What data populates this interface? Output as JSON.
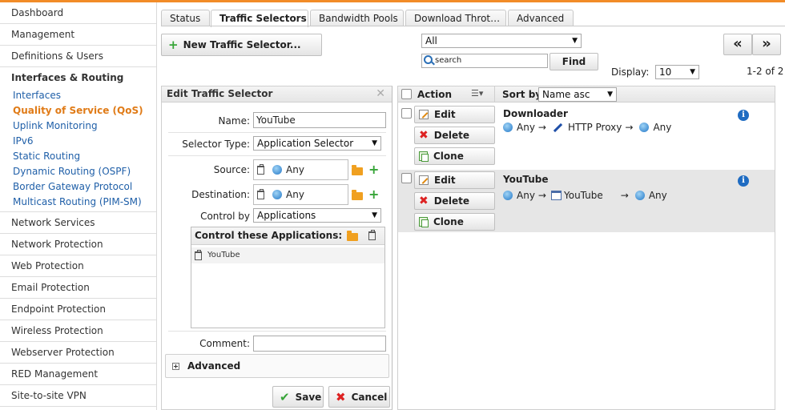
{
  "sidebar": {
    "items_top": [
      "Dashboard",
      "Management",
      "Definitions & Users"
    ],
    "active_section": "Interfaces & Routing",
    "sub_items": [
      "Interfaces",
      "Quality of Service (QoS)",
      "Uplink Monitoring",
      "IPv6",
      "Static Routing",
      "Dynamic Routing (OSPF)",
      "Border Gateway Protocol",
      "Multicast Routing (PIM-SM)"
    ],
    "items_bottom": [
      "Network Services",
      "Network Protection",
      "Web Protection",
      "Email Protection",
      "Endpoint Protection",
      "Wireless Protection",
      "Webserver Protection",
      "RED Management",
      "Site-to-site VPN"
    ]
  },
  "tabs": [
    "Status",
    "Traffic Selectors",
    "Bandwidth Pools",
    "Download Throt…",
    "Advanced"
  ],
  "toolbar": {
    "new_button": "New Traffic Selector...",
    "filter_value": "All",
    "search_value": "search",
    "find_button": "Find",
    "display_label": "Display:",
    "display_value": "10",
    "page_info": "1-2 of 2",
    "prev_label": "«",
    "next_label": "»"
  },
  "edit": {
    "title": "Edit Traffic Selector",
    "close": "✕",
    "name_label": "Name:",
    "name_value": "YouTube",
    "selector_type_label": "Selector Type:",
    "selector_type_value": "Application Selector",
    "source_label": "Source:",
    "source_value": "Any",
    "destination_label": "Destination:",
    "destination_value": "Any",
    "control_by_label": "Control by",
    "control_by_value": "Applications",
    "apps_header": "Control these Applications:",
    "apps": [
      "YouTube"
    ],
    "comment_label": "Comment:",
    "comment_value": "",
    "advanced_label": "Advanced",
    "save_label": "Save",
    "cancel_label": "Cancel"
  },
  "list": {
    "action_header": "Action",
    "sort_label": "Sort by:",
    "sort_value": "Name asc",
    "actions": {
      "edit": "Edit",
      "delete": "Delete",
      "clone": "Clone"
    },
    "rows": [
      {
        "title": "Downloader",
        "source": "Any",
        "arrow": "→",
        "service": "HTTP Proxy",
        "destination": "Any"
      },
      {
        "title": "YouTube",
        "source": "Any",
        "arrow": "→",
        "service": "YouTube",
        "destination": "Any"
      }
    ],
    "info": "i"
  },
  "colors": {
    "accent": "#f28c28",
    "link": "#1f5fa8",
    "active_link": "#e07b17",
    "green": "#37a538",
    "red": "#dd2222"
  }
}
